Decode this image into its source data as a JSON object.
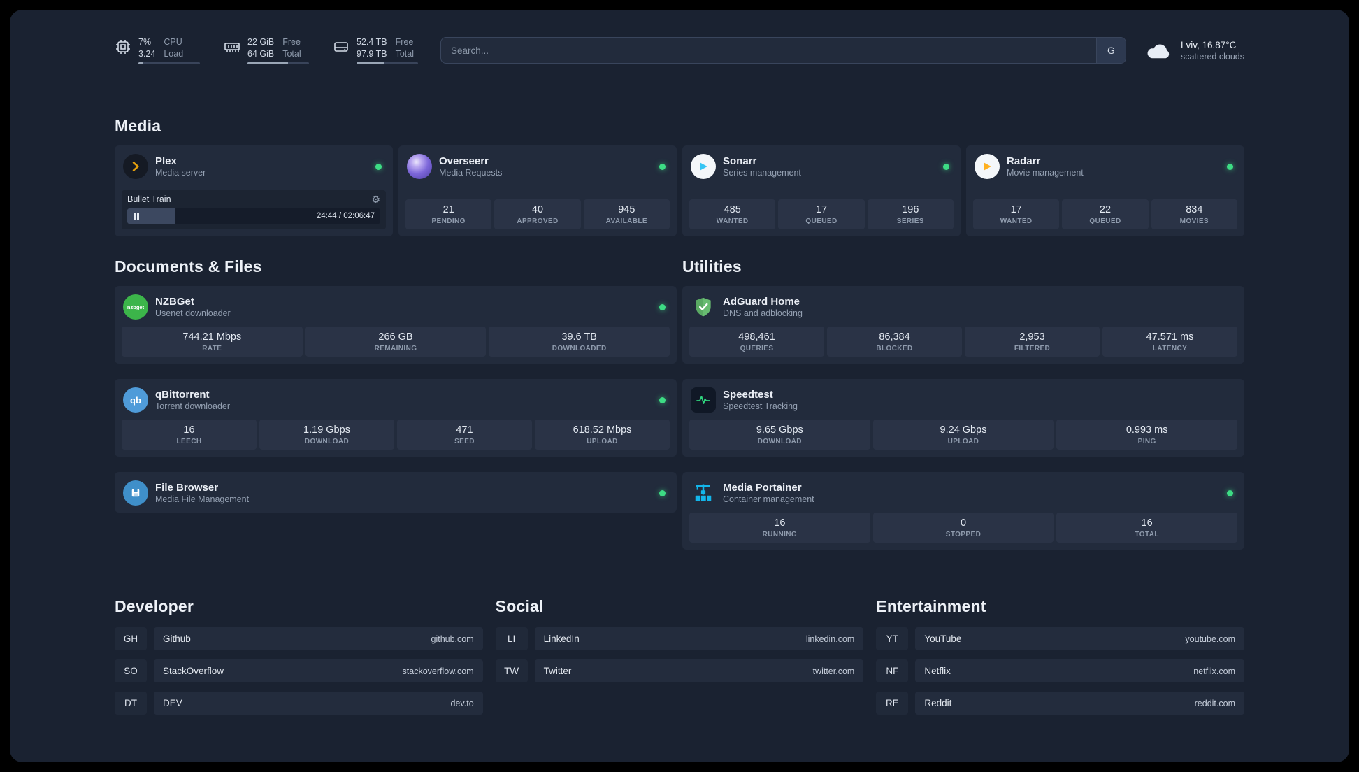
{
  "colors": {
    "status_online": "#3ddc84",
    "plex_orange": "#e5a00d",
    "overseerr_purple": "#6d5bd0",
    "sonarr_blue": "#35c5f4",
    "radarr_yellow": "#ffc230",
    "nzbget_green": "#3cb54a",
    "qbittorrent_blue": "#4f9bd9",
    "filebrowser_blue": "#3f8fc9",
    "adguard_green": "#68bc71",
    "speedtest_green": "#2fd27d",
    "portainer_blue": "#13b5ea"
  },
  "icons": {
    "gear": "⚙",
    "nzbget_label": "nzbget",
    "qbittorrent_label": "qb"
  },
  "topbar": {
    "cpu": {
      "usage": "7%",
      "load": "3.24",
      "label_top": "CPU",
      "label_bottom": "Load",
      "bar_width": "7%"
    },
    "memory": {
      "free": "22 GiB",
      "total": "64 GiB",
      "label_top": "Free",
      "label_bottom": "Total",
      "bar_width": "66%"
    },
    "disk": {
      "free": "52.4 TB",
      "total": "97.9 TB",
      "label_top": "Free",
      "label_bottom": "Total",
      "bar_width": "46%"
    },
    "search": {
      "placeholder": "Search...",
      "button_label": "G"
    },
    "weather": {
      "location": "Lviv, 16.87°C",
      "condition": "scattered clouds"
    }
  },
  "sections": {
    "media": {
      "title": "Media",
      "plex": {
        "title": "Plex",
        "subtitle": "Media server",
        "now_playing": {
          "title": "Bullet Train",
          "time": "24:44 / 02:06:47",
          "progress_width": "19%"
        }
      },
      "overseerr": {
        "title": "Overseerr",
        "subtitle": "Media Requests",
        "stats": [
          {
            "value": "21",
            "label": "PENDING"
          },
          {
            "value": "40",
            "label": "APPROVED"
          },
          {
            "value": "945",
            "label": "AVAILABLE"
          }
        ]
      },
      "sonarr": {
        "title": "Sonarr",
        "subtitle": "Series management",
        "stats": [
          {
            "value": "485",
            "label": "WANTED"
          },
          {
            "value": "17",
            "label": "QUEUED"
          },
          {
            "value": "196",
            "label": "SERIES"
          }
        ]
      },
      "radarr": {
        "title": "Radarr",
        "subtitle": "Movie management",
        "stats": [
          {
            "value": "17",
            "label": "WANTED"
          },
          {
            "value": "22",
            "label": "QUEUED"
          },
          {
            "value": "834",
            "label": "MOVIES"
          }
        ]
      }
    },
    "documents": {
      "title": "Documents & Files",
      "nzbget": {
        "title": "NZBGet",
        "subtitle": "Usenet downloader",
        "stats": [
          {
            "value": "744.21 Mbps",
            "label": "RATE"
          },
          {
            "value": "266 GB",
            "label": "REMAINING"
          },
          {
            "value": "39.6 TB",
            "label": "DOWNLOADED"
          }
        ]
      },
      "qbittorrent": {
        "title": "qBittorrent",
        "subtitle": "Torrent downloader",
        "stats": [
          {
            "value": "16",
            "label": "LEECH"
          },
          {
            "value": "1.19 Gbps",
            "label": "DOWNLOAD"
          },
          {
            "value": "471",
            "label": "SEED"
          },
          {
            "value": "618.52 Mbps",
            "label": "UPLOAD"
          }
        ]
      },
      "filebrowser": {
        "title": "File Browser",
        "subtitle": "Media File Management"
      }
    },
    "utilities": {
      "title": "Utilities",
      "adguard": {
        "title": "AdGuard Home",
        "subtitle": "DNS and adblocking",
        "stats": [
          {
            "value": "498,461",
            "label": "QUERIES"
          },
          {
            "value": "86,384",
            "label": "BLOCKED"
          },
          {
            "value": "2,953",
            "label": "FILTERED"
          },
          {
            "value": "47.571 ms",
            "label": "LATENCY"
          }
        ]
      },
      "speedtest": {
        "title": "Speedtest",
        "subtitle": "Speedtest Tracking",
        "stats": [
          {
            "value": "9.65 Gbps",
            "label": "DOWNLOAD"
          },
          {
            "value": "9.24 Gbps",
            "label": "UPLOAD"
          },
          {
            "value": "0.993 ms",
            "label": "PING"
          }
        ]
      },
      "portainer": {
        "title": "Media Portainer",
        "subtitle": "Container management",
        "stats": [
          {
            "value": "16",
            "label": "RUNNING"
          },
          {
            "value": "0",
            "label": "STOPPED"
          },
          {
            "value": "16",
            "label": "TOTAL"
          }
        ]
      }
    }
  },
  "bookmarks": {
    "developer": {
      "title": "Developer",
      "items": [
        {
          "abbr": "GH",
          "name": "Github",
          "url": "github.com"
        },
        {
          "abbr": "SO",
          "name": "StackOverflow",
          "url": "stackoverflow.com"
        },
        {
          "abbr": "DT",
          "name": "DEV",
          "url": "dev.to"
        }
      ]
    },
    "social": {
      "title": "Social",
      "items": [
        {
          "abbr": "LI",
          "name": "LinkedIn",
          "url": "linkedin.com"
        },
        {
          "abbr": "TW",
          "name": "Twitter",
          "url": "twitter.com"
        }
      ]
    },
    "entertainment": {
      "title": "Entertainment",
      "items": [
        {
          "abbr": "YT",
          "name": "YouTube",
          "url": "youtube.com"
        },
        {
          "abbr": "NF",
          "name": "Netflix",
          "url": "netflix.com"
        },
        {
          "abbr": "RE",
          "name": "Reddit",
          "url": "reddit.com"
        }
      ]
    }
  }
}
